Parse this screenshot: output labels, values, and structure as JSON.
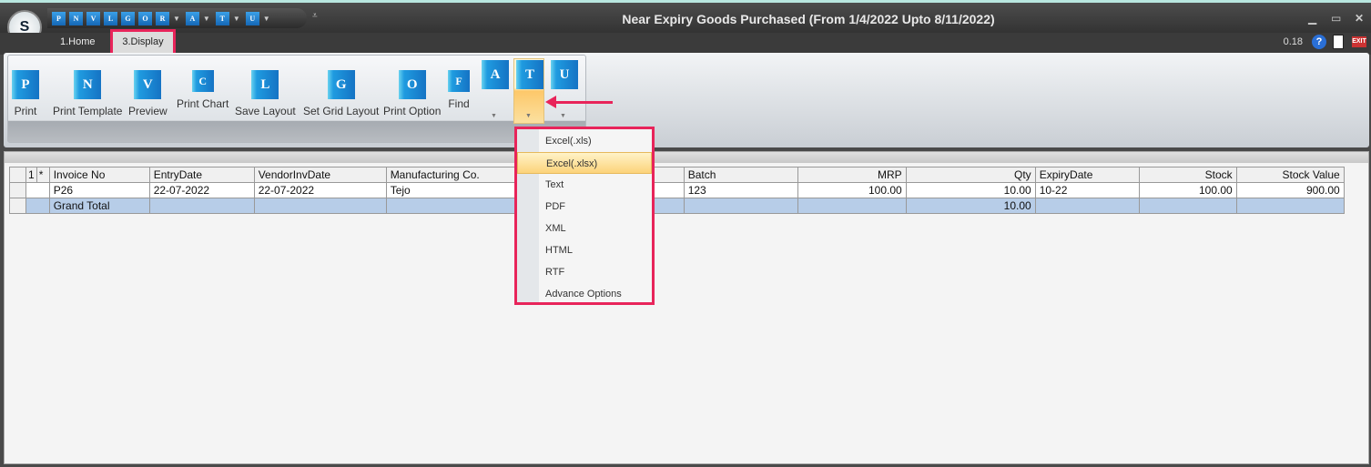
{
  "window": {
    "title": "Near Expiry Goods Purchased (From 1/4/2022 Upto 8/11/2022)",
    "logo": "S"
  },
  "quick_access": [
    "P",
    "N",
    "V",
    "L",
    "G",
    "O",
    "R",
    "A",
    "T",
    "U"
  ],
  "tabs": [
    {
      "label": "1.Home"
    },
    {
      "label": "3.Display",
      "selected": true
    }
  ],
  "status": {
    "version": "0.18"
  },
  "ribbon": {
    "buttons": [
      {
        "label": "Print",
        "icon": "P"
      },
      {
        "label": "Print Template",
        "icon": "N"
      },
      {
        "label": "Preview",
        "icon": "V"
      },
      {
        "label": "Print Chart",
        "icon": "C"
      },
      {
        "label": "Save Layout",
        "icon": "L"
      },
      {
        "label": "Set Grid Layout",
        "icon": "G"
      },
      {
        "label": "Print Option",
        "icon": "O"
      },
      {
        "label": "Find",
        "icon": "F"
      }
    ],
    "dropdowns": [
      {
        "icon": "A"
      },
      {
        "icon": "T",
        "active": true
      },
      {
        "icon": "U"
      }
    ]
  },
  "grid": {
    "headers": [
      "1",
      "*",
      "Invoice No",
      "EntryDate",
      "VendorInvDate",
      "Manufacturing Co.",
      "",
      "Batch",
      "MRP",
      "Qty",
      "ExpiryDate",
      "Stock",
      "Stock Value"
    ],
    "rows": [
      [
        "",
        "",
        "P26",
        "22-07-2022",
        "22-07-2022",
        "Tejo",
        "",
        "123",
        "100.00",
        "10.00",
        "10-22",
        "100.00",
        "900.00"
      ]
    ],
    "total": [
      "",
      "",
      "Grand Total",
      "",
      "",
      "",
      "",
      "",
      "",
      "10.00",
      "",
      "",
      ""
    ]
  },
  "export_menu": {
    "items": [
      "Excel(.xls)",
      "Excel(.xlsx)",
      "Text",
      "PDF",
      "XML",
      "HTML",
      "RTF",
      "Advance Options"
    ],
    "highlighted": "Excel(.xlsx)"
  },
  "colors": {
    "highlight_border": "#e8245a",
    "grand_total": "#b7cde8",
    "icon_blue": "#1573c4"
  }
}
